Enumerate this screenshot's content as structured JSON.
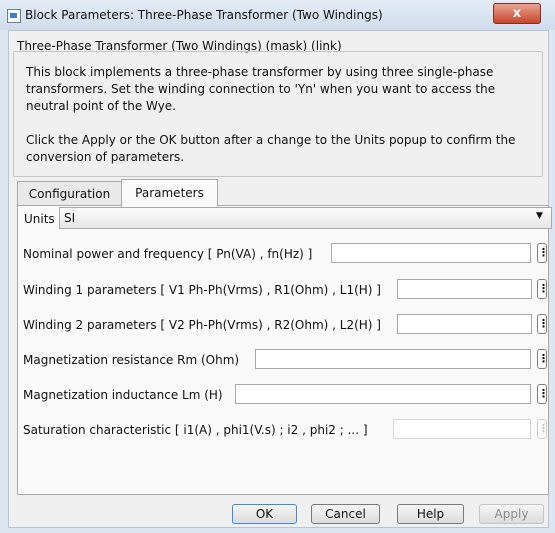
{
  "window": {
    "title": "Block Parameters: Three-Phase Transformer (Two Windings)",
    "close_symbol": "x"
  },
  "mask": {
    "title": "Three-Phase Transformer (Two Windings) (mask) (link)",
    "description_1": "This block implements a three-phase transformer by using three single-phase transformers. Set the winding connection to 'Yn'  when you want to access the neutral point of the Wye.",
    "description_2": "Click the Apply or the OK button after a change to the Units popup to confirm the conversion of parameters."
  },
  "tabs": [
    {
      "label": "Configuration",
      "active": false
    },
    {
      "label": "Parameters",
      "active": true
    }
  ],
  "units": {
    "label": "Units",
    "selected": "SI"
  },
  "parameters": [
    {
      "label": "Nominal power and frequency  [ Pn(VA) , fn(Hz) ]",
      "value": "",
      "enabled": true
    },
    {
      "label": "Winding 1 parameters [ V1 Ph-Ph(Vrms) , R1(Ohm) , L1(H) ]",
      "value": "",
      "enabled": true
    },
    {
      "label": "Winding 2 parameters [ V2 Ph-Ph(Vrms) , R2(Ohm) , L2(H) ]",
      "value": "",
      "enabled": true
    },
    {
      "label": "Magnetization resistance  Rm (Ohm)",
      "value": "",
      "enabled": true
    },
    {
      "label": "Magnetization inductance  Lm (H)",
      "value": "",
      "enabled": true
    },
    {
      "label": "Saturation characteristic [ i1(A) ,  phi1(V.s) ;  i2 , phi2 ; ... ]",
      "value": "",
      "enabled": false
    }
  ],
  "menu_symbol": "⋮",
  "buttons": {
    "ok": "OK",
    "cancel": "Cancel",
    "help": "Help",
    "apply": "Apply"
  }
}
